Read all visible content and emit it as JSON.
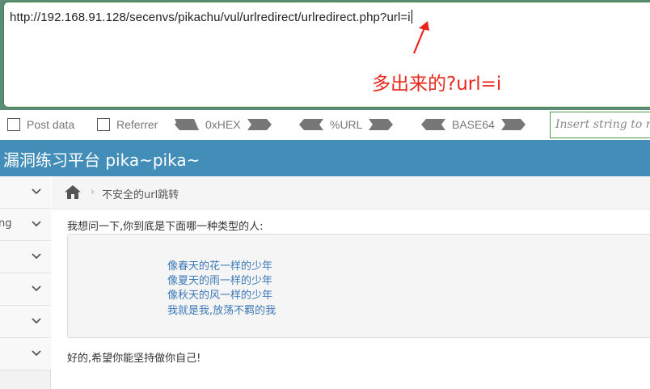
{
  "hackbar": {
    "url": "http://192.168.91.128/secenvs/pikachu/vul/urlredirect/urlredirect.php?url=i",
    "annotation": "多出来的?url=i",
    "post_data_label": "Post data",
    "referrer_label": "Referrer",
    "hex_label": "0xHEX",
    "url_encode_label": "%URL",
    "base64_label": "BASE64",
    "insert_placeholder": "Insert string to replace"
  },
  "header": {
    "title": "漏洞练习平台 pika~pika~"
  },
  "sidebar": {
    "items": [
      {
        "label": ""
      },
      {
        "label": "ng"
      },
      {
        "label": ""
      },
      {
        "label": ""
      },
      {
        "label": ""
      },
      {
        "label": ""
      }
    ]
  },
  "breadcrumb": {
    "current": "不安全的url跳转"
  },
  "main": {
    "question": "我想问一下,你到底是下面哪一种类型的人:",
    "options": [
      "像春天的花一样的少年",
      "像夏天的雨一样的少年",
      "像秋天的风一样的少年",
      "我就是我,放荡不羁的我"
    ],
    "answer": "好的,希望你能坚持做你自己!"
  },
  "colors": {
    "header_bg": "#438eb9",
    "link": "#3d7ab8",
    "annotation": "#e8261b"
  }
}
